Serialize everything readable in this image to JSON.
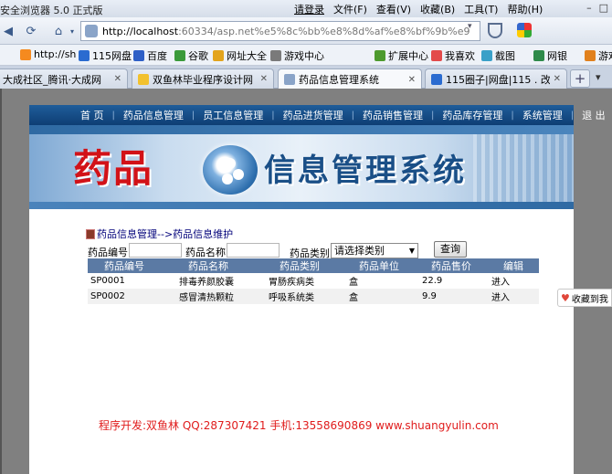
{
  "browser": {
    "title": "安全浏览器 5.0 正式版",
    "menu": [
      "请登录",
      "文件(F)",
      "查看(V)",
      "收藏(B)",
      "工具(T)",
      "帮助(H)"
    ],
    "address_host": "http://localhost",
    "address_path": ":60334/asp.net%e5%8c%bb%e8%8d%af%e8%bf%9b%e9",
    "favorites": [
      "http://sh",
      "115网盘",
      "百度",
      "谷歌",
      "网址大全",
      "游戏中心",
      "扩展中心",
      "我喜欢",
      "截图",
      "网银",
      "游戏"
    ],
    "tabs": [
      {
        "label": "大成社区_腾讯·大成网"
      },
      {
        "label": "双鱼林毕业程序设计网 [..."
      },
      {
        "label": "药品信息管理系统"
      },
      {
        "label": "115圈子|网盘|115 . 改..."
      }
    ]
  },
  "site": {
    "nav": [
      "首 页",
      "药品信息管理",
      "员工信息管理",
      "药品进货管理",
      "药品销售管理",
      "药品库存管理",
      "系统管理",
      "退 出"
    ],
    "banner_title_red": "药品",
    "banner_title_blue": "信息管理系统",
    "breadcrumb": "药品信息管理-->药品信息维护",
    "search": {
      "code_label": "药品编号:",
      "name_label": "药品名称:",
      "category_label": "药品类别:",
      "category_selected": "请选择类别",
      "query_button": "查询"
    },
    "table": {
      "headers": [
        "药品编号",
        "药品名称",
        "药品类别",
        "药品单位",
        "药品售价",
        "编辑"
      ],
      "rows": [
        [
          "SP0001",
          "排毒养颜胶囊",
          "胃肠疾病类",
          "盒",
          "22.9",
          "进入"
        ],
        [
          "SP0002",
          "感冒清热颗粒",
          "呼吸系统类",
          "盒",
          "9.9",
          "进入"
        ]
      ]
    },
    "footer": "程序开发:双鱼林 QQ:287307421 手机:13558690869 www.shuangyulin.com",
    "side_float": "收藏到我"
  }
}
